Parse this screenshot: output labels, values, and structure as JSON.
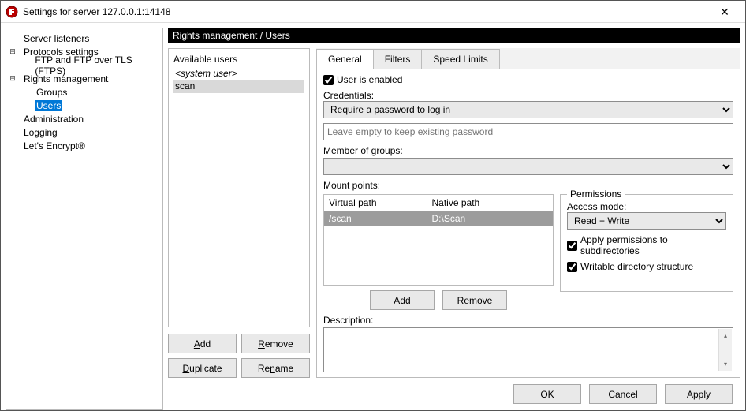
{
  "window": {
    "title": "Settings for server 127.0.0.1:14148"
  },
  "tree": {
    "server_listeners": "Server listeners",
    "protocols": "Protocols settings",
    "ftp_tls": "FTP and FTP over TLS (FTPS)",
    "rights": "Rights management",
    "groups": "Groups",
    "users": "Users",
    "admin": "Administration",
    "logging": "Logging",
    "letsencrypt": "Let's Encrypt®"
  },
  "header": "Rights management / Users",
  "users": {
    "label": "Available users",
    "items": [
      "<system user>",
      "scan"
    ],
    "add": "Add",
    "remove": "Remove",
    "duplicate": "Duplicate",
    "rename": "Rename"
  },
  "tabs": {
    "general": "General",
    "filters": "Filters",
    "speed": "Speed Limits"
  },
  "general": {
    "enabled_label": "User is enabled",
    "credentials_label": "Credentials:",
    "cred_option": "Require a password to log in",
    "password_placeholder": "Leave empty to keep existing password",
    "member_label": "Member of groups:",
    "mount_label": "Mount points:",
    "col_virtual": "Virtual path",
    "col_native": "Native path",
    "mount_rows": [
      {
        "virtual": "/scan",
        "native": "D:\\Scan"
      }
    ],
    "add": "Add",
    "remove": "Remove",
    "perms_legend": "Permissions",
    "access_label": "Access mode:",
    "access_value": "Read + Write",
    "apply_sub": "Apply permissions to subdirectories",
    "writable": "Writable directory structure",
    "desc_label": "Description:"
  },
  "buttons": {
    "ok": "OK",
    "cancel": "Cancel",
    "apply": "Apply"
  }
}
